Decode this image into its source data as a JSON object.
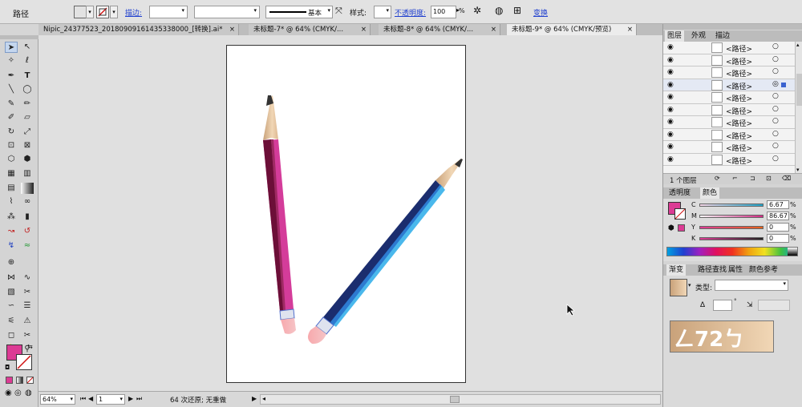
{
  "control_bar": {
    "object_type": "路径",
    "fill_color": "#dc3b94",
    "stroke_label": "描边:",
    "stroke_style": "基本",
    "style_label": "样式:",
    "opacity_label": "不透明度:",
    "opacity_value": "100",
    "opacity_unit": "%",
    "transform_label": "变换"
  },
  "tabs": [
    {
      "label": "Nipic_24377523_20180909161435338000_[转换].ai*",
      "close": "×",
      "active": false
    },
    {
      "label": "未标题-7* @ 64% (CMYK/...",
      "close": "×",
      "active": false
    },
    {
      "label": "未标题-8* @ 64% (CMYK/...",
      "close": "×",
      "active": false
    },
    {
      "label": "未标题-9* @ 64% (CMYK/预览)",
      "close": "×",
      "active": true
    }
  ],
  "status_bar": {
    "zoom": "64%",
    "page": "1",
    "history": "64 次还原; 无重做"
  },
  "layers_panel": {
    "tabs": [
      "图层",
      "外观",
      "描边"
    ],
    "rows": [
      {
        "label": "<路径>"
      },
      {
        "label": "<路径>"
      },
      {
        "label": "<路径>"
      },
      {
        "label": "<路径>"
      },
      {
        "label": "<路径>"
      },
      {
        "label": "<路径>"
      },
      {
        "label": "<路径>"
      },
      {
        "label": "<路径>"
      },
      {
        "label": "<路径>"
      },
      {
        "label": "<路径>"
      }
    ],
    "footer": "1 个图层"
  },
  "color_panel": {
    "tabs": [
      "透明度",
      "颜色"
    ],
    "channels": [
      {
        "name": "C",
        "value": "6.67",
        "color": "#1fa3c8"
      },
      {
        "name": "M",
        "value": "86.67",
        "color": "#d22a84"
      },
      {
        "name": "Y",
        "value": "0",
        "color": "#e6c21a"
      },
      {
        "name": "K",
        "value": "0",
        "color": "#222222"
      }
    ],
    "fill_color": "#dc3b94"
  },
  "gradient_panel": {
    "tabs": [
      "渐变",
      "路径查找",
      "属性",
      "颜色参考"
    ],
    "type_label": "类型:"
  },
  "watermark": "ㄥ72ㄅ",
  "icons": [
    "selection-icon",
    "direct-selection-icon",
    "pen-icon",
    "type-icon",
    "brush-icon",
    "pencil-icon",
    "rotate-icon",
    "scale-icon",
    "eyedropper-icon",
    "hand-icon",
    "zoom-icon"
  ]
}
